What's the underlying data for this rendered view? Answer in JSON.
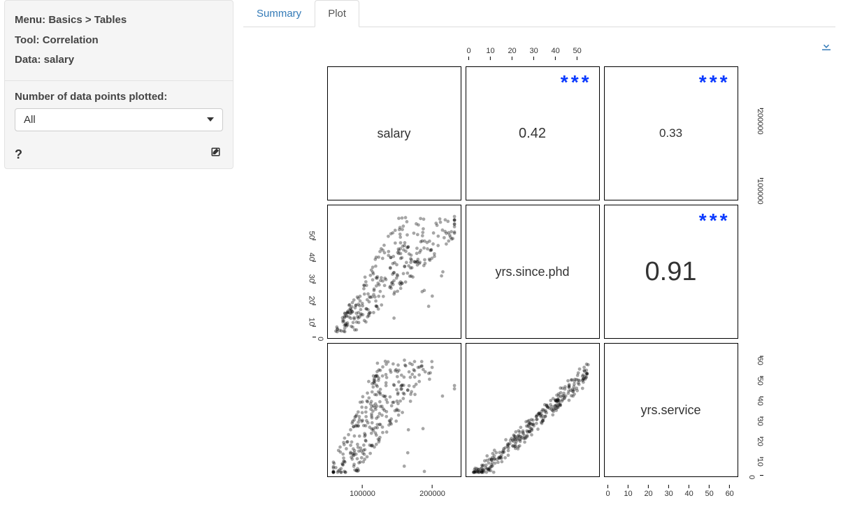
{
  "sidebar": {
    "menu_line": "Menu: Basics > Tables",
    "tool_line": "Tool: Correlation",
    "data_line": "Data: salary",
    "npoints_label": "Number of data points plotted:",
    "npoints_value": "All",
    "help_tooltip": "?"
  },
  "tabs": {
    "summary": "Summary",
    "plot": "Plot",
    "active": "plot"
  },
  "plot": {
    "download_label": "Download plot"
  },
  "chart_data": {
    "type": "scatter-matrix",
    "variables": [
      "salary",
      "yrs.since.phd",
      "yrs.service"
    ],
    "correlations": [
      {
        "row": "salary",
        "col": "yrs.since.phd",
        "r": 0.42,
        "sig": "***"
      },
      {
        "row": "salary",
        "col": "yrs.service",
        "r": 0.33,
        "sig": "***"
      },
      {
        "row": "yrs.since.phd",
        "col": "yrs.service",
        "r": 0.91,
        "sig": "***"
      }
    ],
    "axes": {
      "salary_ticks": [
        100000,
        200000
      ],
      "salary_range": [
        55000,
        235000
      ],
      "yrs_since_phd_ticks": [
        0,
        10,
        20,
        30,
        40,
        50
      ],
      "yrs_since_phd_range": [
        0,
        58
      ],
      "yrs_service_ticks": [
        0,
        10,
        20,
        30,
        40,
        50,
        60
      ],
      "yrs_service_range": [
        0,
        62
      ]
    },
    "corr_display": {
      "c12": "0.42",
      "c13": "0.33",
      "c23": "0.91",
      "stars": "***"
    }
  }
}
